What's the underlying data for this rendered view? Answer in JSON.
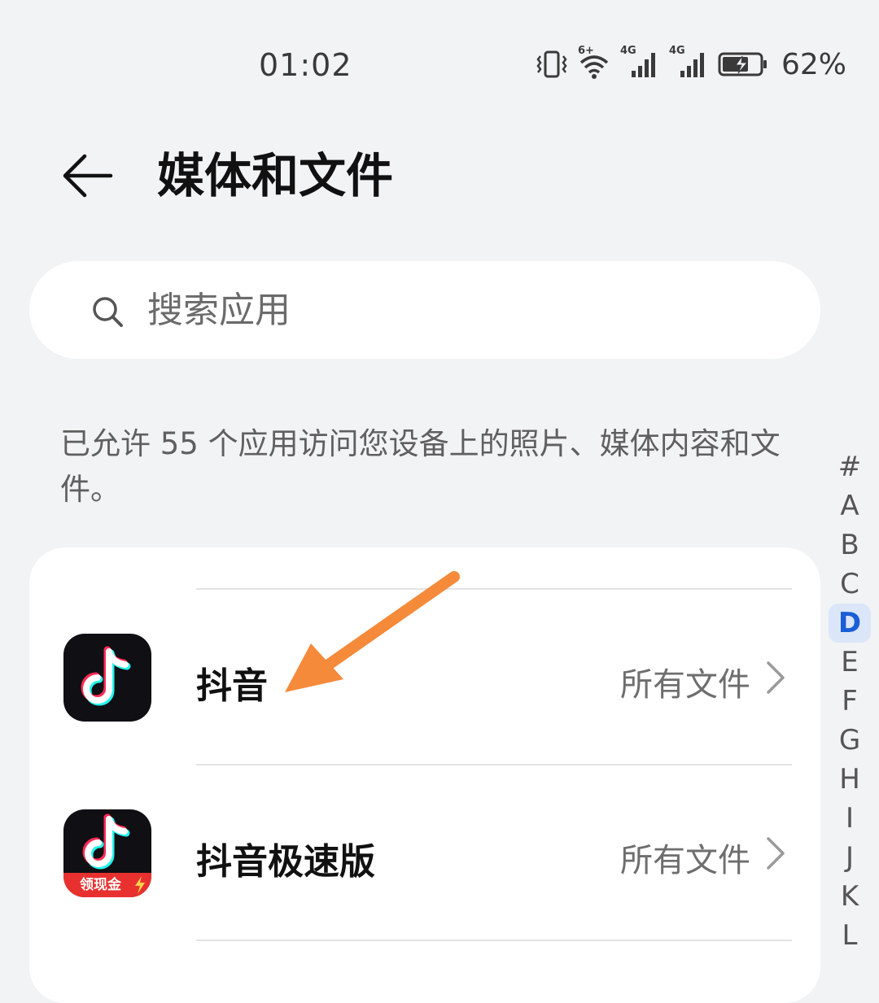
{
  "status_bar": {
    "time": "01:02",
    "network_1": "4G",
    "network_2": "4G",
    "wifi_badge": "6+",
    "battery": "62%"
  },
  "header": {
    "title": "媒体和文件"
  },
  "search": {
    "placeholder": "搜索应用"
  },
  "description": "已允许 55 个应用访问您设备上的照片、媒体内容和文件。",
  "apps": [
    {
      "name": "抖音",
      "status": "所有文件",
      "icon": "douyin-icon"
    },
    {
      "name": "抖音极速版",
      "status": "所有文件",
      "icon": "douyin-lite-icon",
      "badge": "领现金"
    }
  ],
  "index_letters": [
    "#",
    "A",
    "B",
    "C",
    "D",
    "E",
    "F",
    "G",
    "H",
    "I",
    "J",
    "K",
    "L"
  ],
  "active_index": "D",
  "colors": {
    "background": "#f1f3f5",
    "accent": "#1a5fd6",
    "annotation_arrow": "#f58a3a"
  }
}
